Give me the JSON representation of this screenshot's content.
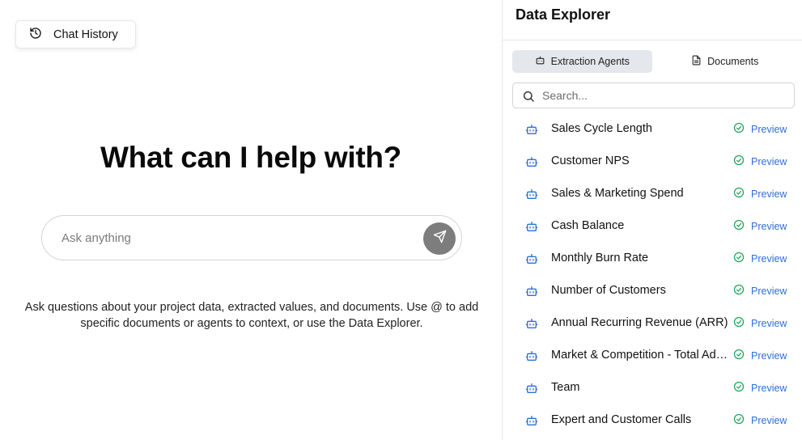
{
  "chat": {
    "history_label": "Chat History",
    "heading": "What can I help with?",
    "input_placeholder": "Ask anything",
    "input_value": "",
    "help_text": "Ask questions about your project data, extracted values, and documents. Use @ to add specific documents or agents to context, or use the Data Explorer."
  },
  "panel": {
    "title": "Data Explorer",
    "tabs": [
      {
        "label": "Extraction Agents",
        "icon": "robot-icon",
        "active": true
      },
      {
        "label": "Documents",
        "icon": "document-icon",
        "active": false
      }
    ],
    "search_placeholder": "Search...",
    "preview_label": "Preview",
    "agents": [
      {
        "name": "Sales Cycle Length"
      },
      {
        "name": "Customer NPS"
      },
      {
        "name": "Sales & Marketing Spend"
      },
      {
        "name": "Cash Balance"
      },
      {
        "name": "Monthly Burn Rate"
      },
      {
        "name": "Number of Customers"
      },
      {
        "name": "Annual Recurring Revenue (ARR)"
      },
      {
        "name": "Market & Competition - Total Addressable Market"
      },
      {
        "name": "Team"
      },
      {
        "name": "Expert and Customer Calls"
      }
    ]
  },
  "colors": {
    "accent": "#2f6fd6",
    "success": "#22a55a",
    "send_button": "#7d7d7d",
    "active_tab": "#e4e7ec"
  }
}
